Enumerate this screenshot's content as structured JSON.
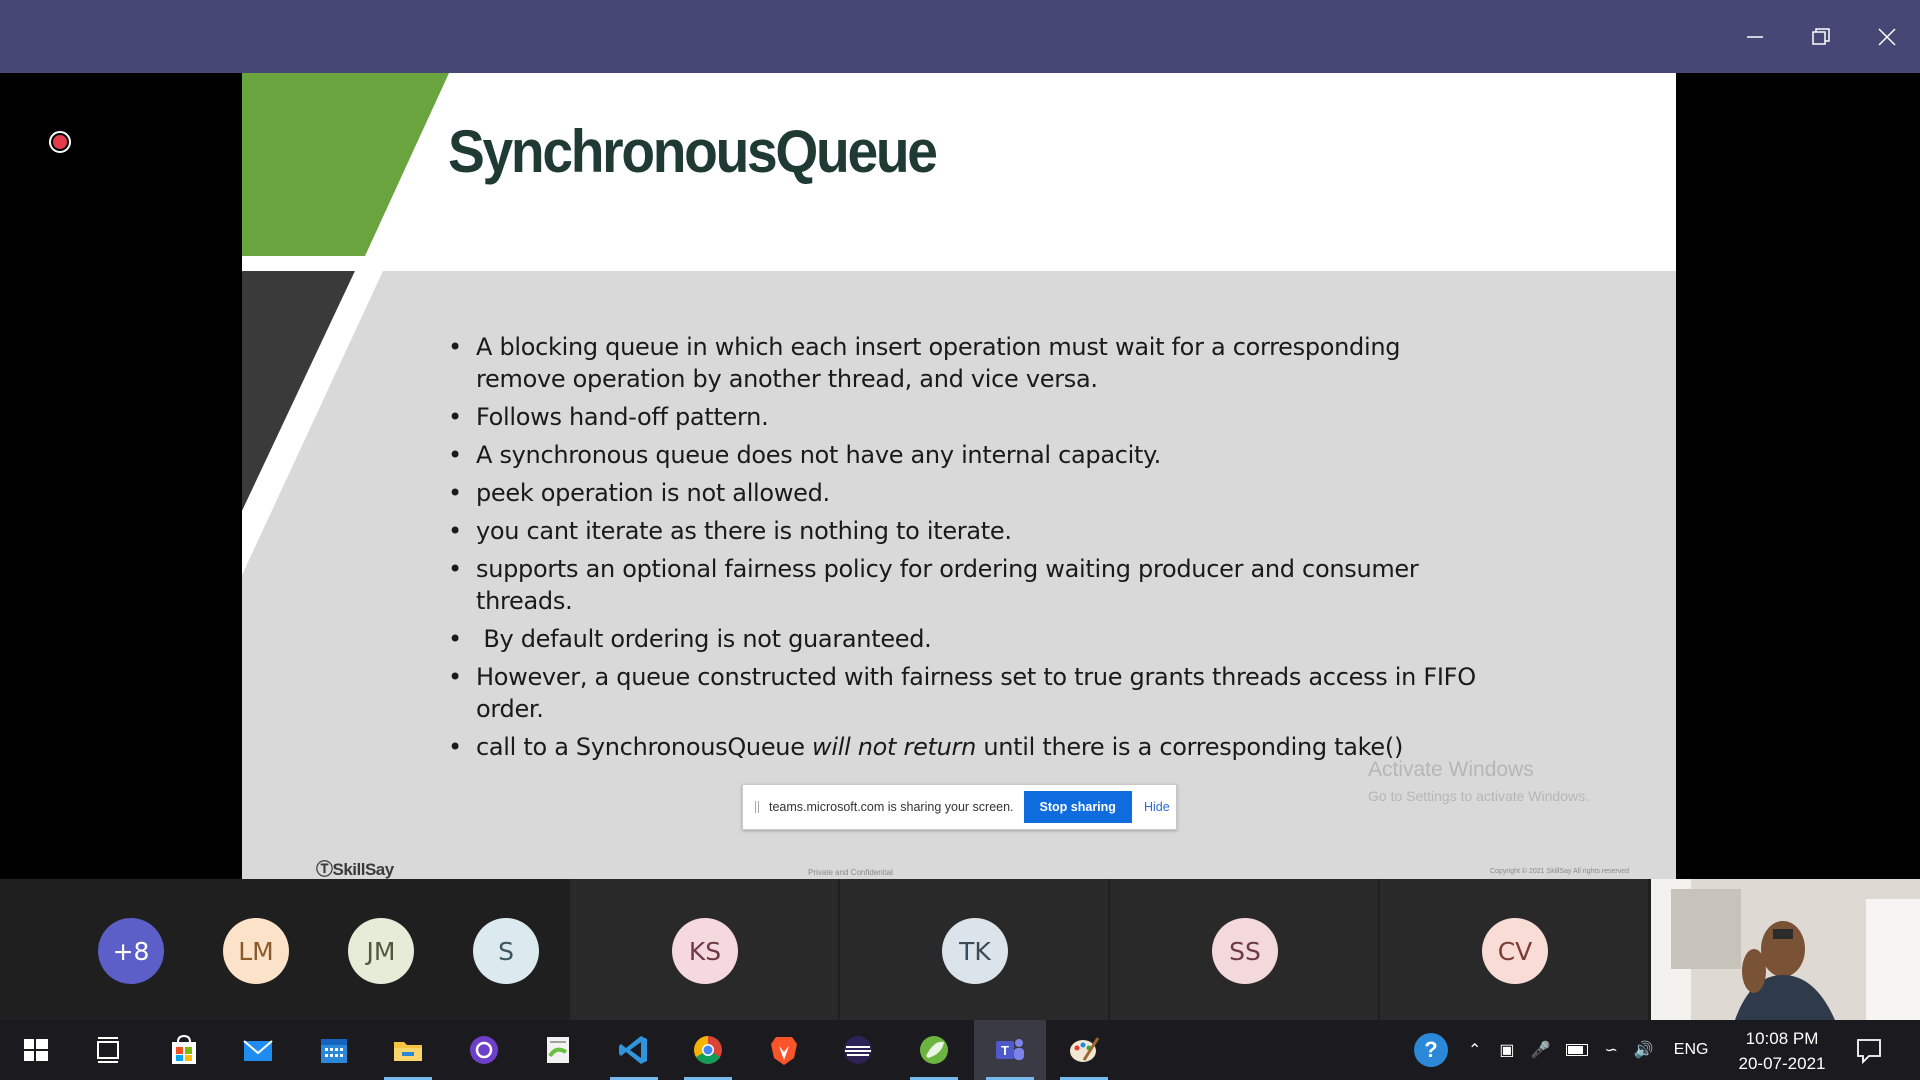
{
  "slide": {
    "title": "SynchronousQueue",
    "bullets": [
      "A blocking queue in which each insert operation must wait for a corresponding remove operation by another thread, and vice versa.",
      "Follows hand-off pattern.",
      "A synchronous queue does not have any internal capacity.",
      "peek operation is not allowed.",
      "you cant iterate as there is nothing to iterate.",
      "supports an optional fairness policy for ordering waiting producer and consumer threads.",
      " By default ordering is not guaranteed.",
      "However, a queue constructed with fairness set to true grants threads access in FIFO order."
    ],
    "last_bullet": {
      "prefix": "call to a SynchronousQueue ",
      "italic": "will not return",
      "suffix": " until there is a corresponding take()"
    },
    "brand": "SkillSay",
    "footer_center": "Private and Confidential",
    "footer_right": "Copyright © 2021 SkillSay All rights reserved",
    "colors": {
      "green": "#6aa43f",
      "dark": "#3a3a3a",
      "title": "#1f3a32"
    }
  },
  "watermark": {
    "line1": "Activate Windows",
    "line2": "Go to Settings to activate Windows."
  },
  "share_banner": {
    "text": "teams.microsoft.com is sharing your screen.",
    "stop_label": "Stop sharing",
    "hide_label": "Hide"
  },
  "participants": [
    {
      "initials": "+8",
      "bg": "#5b5fc7",
      "fg": "#ffffff"
    },
    {
      "initials": "LM",
      "bg": "#fbe2c8",
      "fg": "#8a5a2b"
    },
    {
      "initials": "JM",
      "bg": "#e6ecd7",
      "fg": "#4f5a3c"
    },
    {
      "initials": "S",
      "bg": "#dce9ee",
      "fg": "#3c5560"
    },
    {
      "initials": "KS",
      "bg": "#f6d9de",
      "fg": "#6e3b45"
    },
    {
      "initials": "TK",
      "bg": "#dbe4ea",
      "fg": "#3c4a55"
    },
    {
      "initials": "SS",
      "bg": "#f3d9dc",
      "fg": "#6e3b45"
    },
    {
      "initials": "CV",
      "bg": "#fadcd6",
      "fg": "#7a3e33"
    }
  ],
  "taskbar": {
    "icons": [
      "windows-start-icon",
      "task-view-icon",
      "store-icon",
      "mail-icon",
      "calendar-icon",
      "file-explorer-icon",
      "github-desktop-icon",
      "notepad-plus-icon",
      "vscode-icon",
      "chrome-icon",
      "brave-icon",
      "eclipse-icon",
      "spring-tools-icon",
      "teams-icon",
      "paint-icon"
    ],
    "lang": "ENG",
    "time": "10:08 PM",
    "date": "20-07-2021"
  }
}
